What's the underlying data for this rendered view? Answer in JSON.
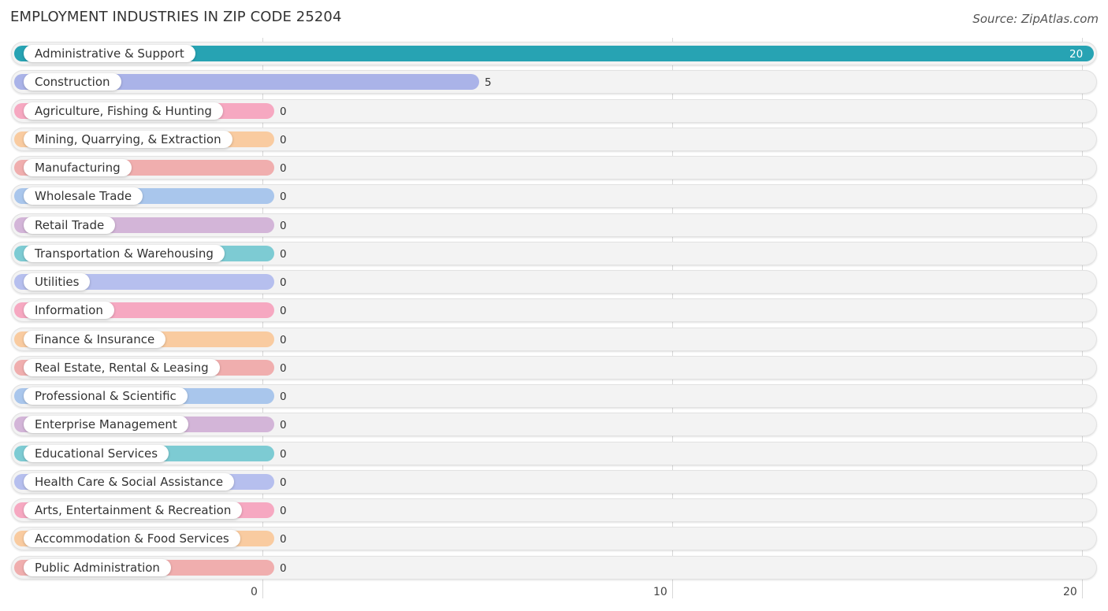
{
  "title": "EMPLOYMENT INDUSTRIES IN ZIP CODE 25204",
  "source": "Source: ZipAtlas.com",
  "chart_data": {
    "type": "bar",
    "orientation": "horizontal",
    "title": "EMPLOYMENT INDUSTRIES IN ZIP CODE 25204",
    "xlabel": "",
    "ylabel": "",
    "xlim": [
      0,
      20
    ],
    "xticks": [
      "0",
      "10",
      "20"
    ],
    "grid": true,
    "categories": [
      "Administrative & Support",
      "Construction",
      "Agriculture, Fishing & Hunting",
      "Mining, Quarrying, & Extraction",
      "Manufacturing",
      "Wholesale Trade",
      "Retail Trade",
      "Transportation & Warehousing",
      "Utilities",
      "Information",
      "Finance & Insurance",
      "Real Estate, Rental & Leasing",
      "Professional & Scientific",
      "Enterprise Management",
      "Educational Services",
      "Health Care & Social Assistance",
      "Arts, Entertainment & Recreation",
      "Accommodation & Food Services",
      "Public Administration"
    ],
    "values": [
      20,
      5,
      0,
      0,
      0,
      0,
      0,
      0,
      0,
      0,
      0,
      0,
      0,
      0,
      0,
      0,
      0,
      0,
      0
    ],
    "value_labels": [
      "20",
      "5",
      "0",
      "0",
      "0",
      "0",
      "0",
      "0",
      "0",
      "0",
      "0",
      "0",
      "0",
      "0",
      "0",
      "0",
      "0",
      "0",
      "0"
    ],
    "colors": [
      "#27a3b3",
      "#aab3e8",
      "#f6a8c1",
      "#f9cba0",
      "#f0aeae",
      "#a9c6ec",
      "#d3b5d8",
      "#7dcbd3",
      "#b6bfee",
      "#f6a8c1",
      "#f9cba0",
      "#f0aeae",
      "#a9c6ec",
      "#d3b5d8",
      "#7dcbd3",
      "#b6bfee",
      "#f6a8c1",
      "#f9cba0",
      "#f0aeae"
    ]
  }
}
